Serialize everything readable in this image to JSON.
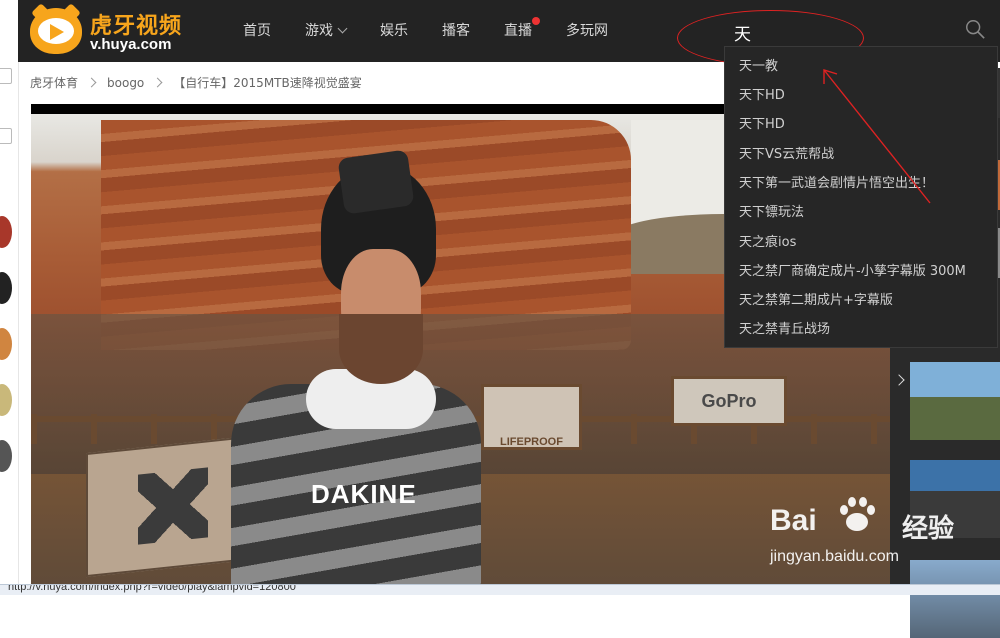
{
  "header": {
    "brand": "虎牙视频",
    "domain": "v.huya.com",
    "nav": [
      {
        "label": "首页"
      },
      {
        "label": "游戏"
      },
      {
        "label": "娱乐"
      },
      {
        "label": "播客"
      },
      {
        "label": "直播"
      },
      {
        "label": "多玩网"
      }
    ],
    "search_query": "天"
  },
  "breadcrumb": [
    "虎牙体育",
    "boogo",
    "【自行车】2015MTB速降视觉盛宴"
  ],
  "suggestions": [
    "天一教",
    "天下HD",
    "天下HD",
    "天下VS云荒帮战",
    "天下第一武道会剧情片悟空出生！",
    "天下镖玩法",
    "天之痕ios",
    "天之禁厂商确定成片-小孳字幕版 300M",
    "天之禁第二期成片+字幕版",
    "天之禁青丘战场"
  ],
  "video": {
    "sign_left": "LIFEPROOF",
    "sign_right": "GoPro",
    "shirt_text": "DAKINE"
  },
  "watermark": {
    "line1_a": "Bai",
    "line1_b": "经验",
    "line2": "jingyan.baidu.com"
  },
  "status_url": "http://v.huya.com/index.php?r=video/play&lampvid=120800",
  "colors": {
    "header_bg": "#232323",
    "brand": "#f7a51c",
    "annotation": "#dd2222",
    "dropdown_bg": "#262626"
  }
}
